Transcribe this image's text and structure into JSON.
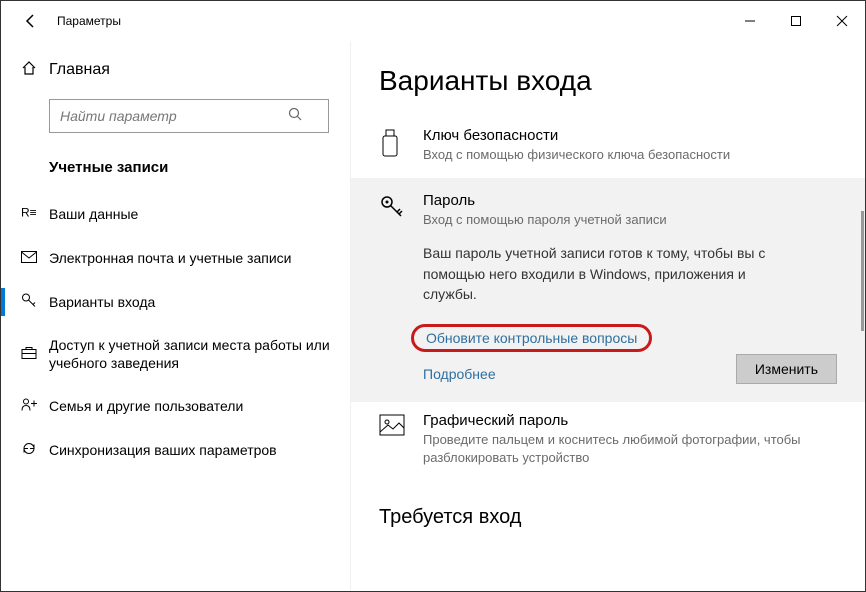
{
  "window": {
    "title": "Параметры"
  },
  "sidebar": {
    "home": "Главная",
    "search_placeholder": "Найти параметр",
    "category": "Учетные записи",
    "items": [
      {
        "label": "Ваши данные"
      },
      {
        "label": "Электронная почта и учетные записи"
      },
      {
        "label": "Варианты входа"
      },
      {
        "label": "Доступ к учетной записи места работы или учебного заведения"
      },
      {
        "label": "Семья и другие пользователи"
      },
      {
        "label": "Синхронизация ваших параметров"
      }
    ]
  },
  "content": {
    "title": "Варианты входа",
    "security_key": {
      "title": "Ключ безопасности",
      "desc": "Вход с помощью физического ключа безопасности"
    },
    "password": {
      "title": "Пароль",
      "desc": "Вход с помощью пароля учетной записи",
      "body": "Ваш пароль учетной записи готов к тому, чтобы вы с помощью него входили в Windows, приложения и службы.",
      "link1": "Обновите контрольные вопросы",
      "link2": "Подробнее",
      "change_btn": "Изменить"
    },
    "picture_password": {
      "title": "Графический пароль",
      "desc": "Проведите пальцем и коснитесь любимой фотографии, чтобы разблокировать устройство"
    },
    "require_login_title": "Требуется вход"
  }
}
